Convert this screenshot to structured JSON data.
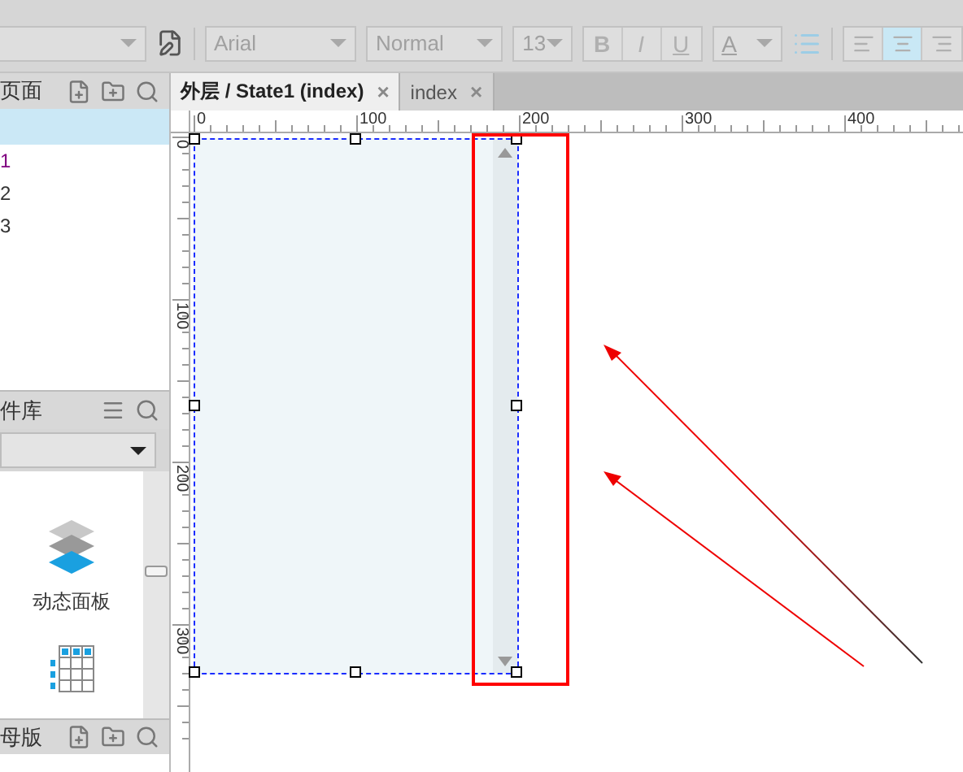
{
  "toolbar": {
    "disabled": true,
    "font": "Arial",
    "weight": "Normal",
    "size": "13",
    "format_buttons": [
      {
        "label": "B",
        "kind": "bold"
      },
      {
        "label": "I",
        "kind": "italic"
      },
      {
        "label": "U",
        "kind": "underline"
      }
    ],
    "font_color": {
      "label": "A"
    },
    "align_buttons": [
      {
        "kind": "left",
        "selected": false
      },
      {
        "kind": "center",
        "selected": true
      },
      {
        "kind": "right",
        "selected": false
      }
    ]
  },
  "pages_panel": {
    "title": "页面",
    "items": [
      {
        "selected": true
      },
      {
        "label": "1",
        "selected": false,
        "color": "#800080"
      },
      {
        "label": "2",
        "selected": false,
        "color": "#333333"
      },
      {
        "label": "3",
        "selected": false,
        "color": "#333333"
      }
    ]
  },
  "library_panel": {
    "title": "件库",
    "items": [
      {
        "kind": "layers",
        "label": "动态面板"
      },
      {
        "kind": "table"
      }
    ]
  },
  "masters_panel": {
    "title": "母版"
  },
  "tabs": [
    {
      "label": "外层 / State1 (index)",
      "selected": true,
      "close": "×"
    },
    {
      "label": "index",
      "selected": false,
      "close": "×"
    }
  ],
  "rulers": {
    "horizontal": [
      "0",
      "100",
      "200",
      "300",
      "400"
    ],
    "vertical": [
      "0",
      "100",
      "200",
      "300"
    ]
  },
  "dynamic_panel": {
    "selected": true
  }
}
